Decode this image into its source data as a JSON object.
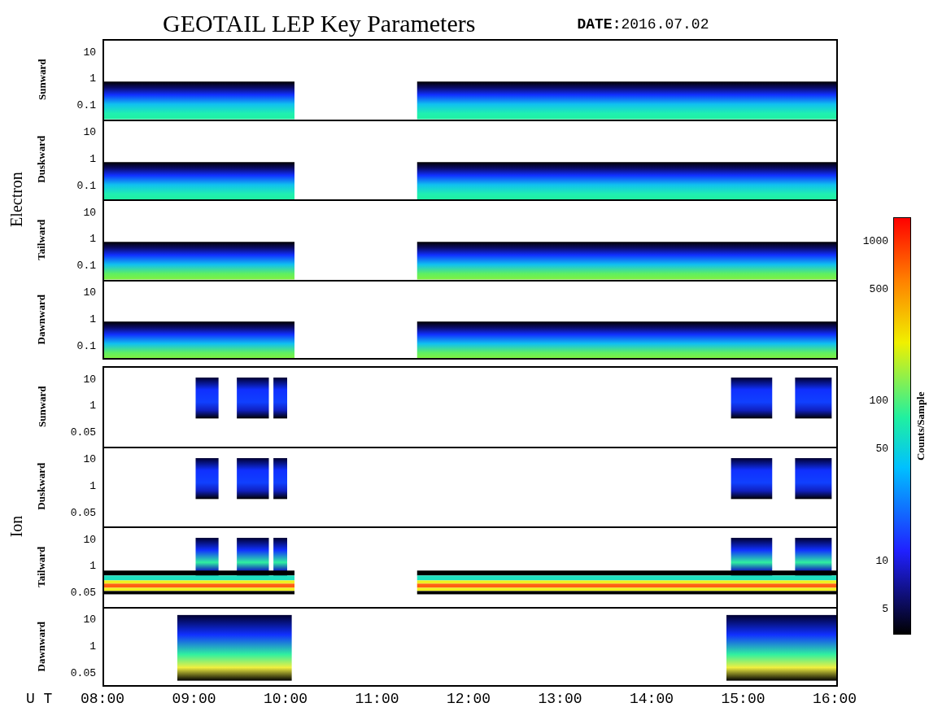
{
  "title": "GEOTAIL LEP Key Parameters",
  "date": {
    "label": "DATE:",
    "value": "2016.07.02"
  },
  "groups": [
    {
      "name": "Electron",
      "kind": "electron",
      "panels": [
        {
          "label": "Sunward",
          "yticks": [
            "10",
            "1",
            "0.1"
          ]
        },
        {
          "label": "Duskward",
          "yticks": [
            "10",
            "1",
            "0.1"
          ]
        },
        {
          "label": "Tailward",
          "yticks": [
            "10",
            "1",
            "0.1"
          ]
        },
        {
          "label": "Dawnward",
          "yticks": [
            "10",
            "1",
            "0.1"
          ]
        }
      ]
    },
    {
      "name": "Ion",
      "kind": "ion",
      "panels": [
        {
          "label": "Sunward",
          "yticks": [
            "10",
            "1",
            "0.05"
          ]
        },
        {
          "label": "Duskward",
          "yticks": [
            "10",
            "1",
            "0.05"
          ]
        },
        {
          "label": "Tailward",
          "yticks": [
            "10",
            "1",
            "0.05"
          ]
        },
        {
          "label": "Dawnward",
          "yticks": [
            "10",
            "1",
            "0.05"
          ]
        }
      ]
    }
  ],
  "x_axis": {
    "label": "U T",
    "ticks": [
      "08:00",
      "09:00",
      "10:00",
      "11:00",
      "12:00",
      "13:00",
      "14:00",
      "15:00",
      "16:00"
    ]
  },
  "colorbar": {
    "label": "Counts/Sample",
    "ticks": [
      "1000",
      "500",
      "100",
      "50",
      "10",
      "5"
    ]
  }
}
